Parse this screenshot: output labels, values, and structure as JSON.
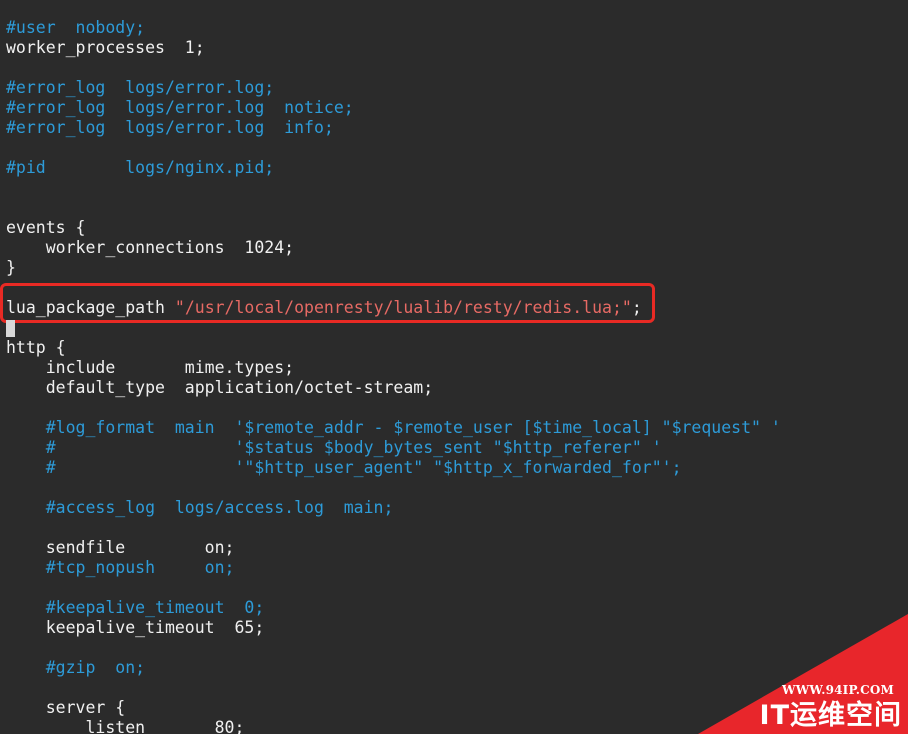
{
  "editor": {
    "lines": [
      [
        {
          "t": "#user  nobody;",
          "c": "comment"
        }
      ],
      [
        {
          "t": "worker_processes  1;",
          "c": "plain"
        }
      ],
      [],
      [
        {
          "t": "#error_log  logs/error.log;",
          "c": "comment"
        }
      ],
      [
        {
          "t": "#error_log  logs/error.log  notice;",
          "c": "comment"
        }
      ],
      [
        {
          "t": "#error_log  logs/error.log  info;",
          "c": "comment"
        }
      ],
      [],
      [
        {
          "t": "#pid        logs/nginx.pid;",
          "c": "comment"
        }
      ],
      [],
      [],
      [
        {
          "t": "events {",
          "c": "plain"
        }
      ],
      [
        {
          "t": "    worker_connections  1024;",
          "c": "plain"
        }
      ],
      [
        {
          "t": "}",
          "c": "plain"
        }
      ],
      [],
      [
        {
          "t": "lua_package_path ",
          "c": "plain"
        },
        {
          "t": "\"/usr/local/openresty/lualib/resty/redis.lua;\"",
          "c": "string"
        },
        {
          "t": ";",
          "c": "plain"
        }
      ],
      [],
      [
        {
          "t": "http {",
          "c": "plain"
        }
      ],
      [
        {
          "t": "    include       mime.types;",
          "c": "plain"
        }
      ],
      [
        {
          "t": "    default_type  application/octet-stream;",
          "c": "plain"
        }
      ],
      [],
      [
        {
          "t": "    #log_format  main  '$remote_addr - $remote_user [$time_local] \"$request\" '",
          "c": "comment"
        }
      ],
      [
        {
          "t": "    #                  '$status $body_bytes_sent \"$http_referer\" '",
          "c": "comment"
        }
      ],
      [
        {
          "t": "    #                  '\"$http_user_agent\" \"$http_x_forwarded_for\"';",
          "c": "comment"
        }
      ],
      [],
      [
        {
          "t": "    #access_log  logs/access.log  main;",
          "c": "comment"
        }
      ],
      [],
      [
        {
          "t": "    sendfile        on;",
          "c": "plain"
        }
      ],
      [
        {
          "t": "    #tcp_nopush     on;",
          "c": "comment"
        }
      ],
      [],
      [
        {
          "t": "    #keepalive_timeout  0;",
          "c": "comment"
        }
      ],
      [
        {
          "t": "    keepalive_timeout  65;",
          "c": "plain"
        }
      ],
      [],
      [
        {
          "t": "    #gzip  on;",
          "c": "comment"
        }
      ],
      [],
      [
        {
          "t": "    server {",
          "c": "plain"
        }
      ],
      [
        {
          "t": "        listen       80;",
          "c": "plain"
        }
      ]
    ]
  },
  "colors": {
    "background": "#2b2b2b",
    "comment": "#2d9bd8",
    "plain": "#f0f0f0",
    "string": "#e76a64",
    "highlight_border": "#e82a24",
    "watermark_bg": "#e8262b"
  },
  "watermark": {
    "url": "WWW.94IP.COM",
    "name": "IT运维空间"
  }
}
